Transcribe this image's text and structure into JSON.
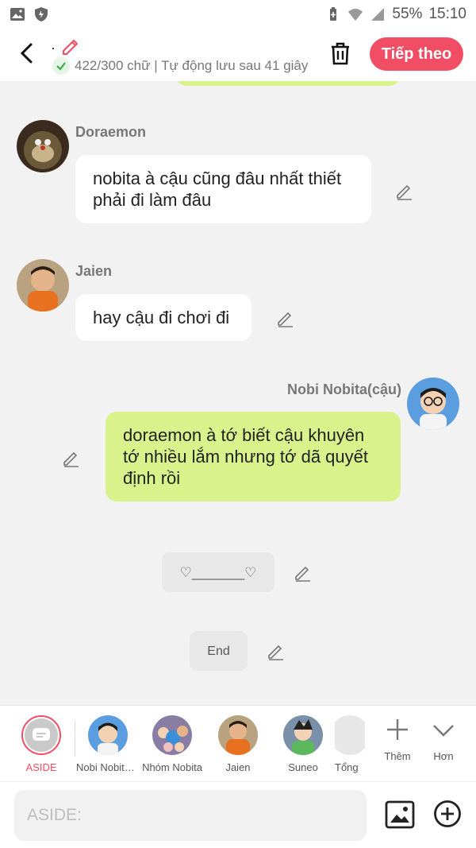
{
  "status_bar": {
    "battery_percent": "55%",
    "time": "15:10",
    "icons": [
      "image-icon",
      "shield-icon",
      "battery-saver-icon",
      "wifi-icon",
      "signal-icon"
    ]
  },
  "header": {
    "title": "·",
    "status_text": "422/300 chữ | Tự động lưu sau 41 giây",
    "next_label": "Tiếp theo",
    "accent": "#f14d64"
  },
  "messages": [
    {
      "name": "Doraemon",
      "text": "nobita à cậu cũng đâu nhất thiết phải đi làm đâu",
      "side": "left"
    },
    {
      "name": "Jaien",
      "text": "hay cậu đi chơi đi",
      "side": "left"
    },
    {
      "name": "Nobi Nobita(cậu)",
      "text": "doraemon à tớ biết cậu khuyên tớ nhiều lắm nhưng tớ dã quyết định rồi",
      "side": "right"
    },
    {
      "text": "♡_______♡",
      "side": "center"
    },
    {
      "text": "End",
      "side": "center"
    }
  ],
  "characters": [
    {
      "label": "ASIDE",
      "active": true
    },
    {
      "label": "Nobi Nobita(cậu)"
    },
    {
      "label": "Nhóm Nobita"
    },
    {
      "label": "Jaien"
    },
    {
      "label": "Suneo"
    },
    {
      "label": "Tổng"
    }
  ],
  "actions": {
    "add_label": "Thêm",
    "more_label": "Hơn"
  },
  "input": {
    "placeholder": "ASIDE:",
    "value": ""
  },
  "colors": {
    "green_bubble": "#d9f28b",
    "white_bubble": "#ffffff",
    "background": "#f2f2f2"
  }
}
